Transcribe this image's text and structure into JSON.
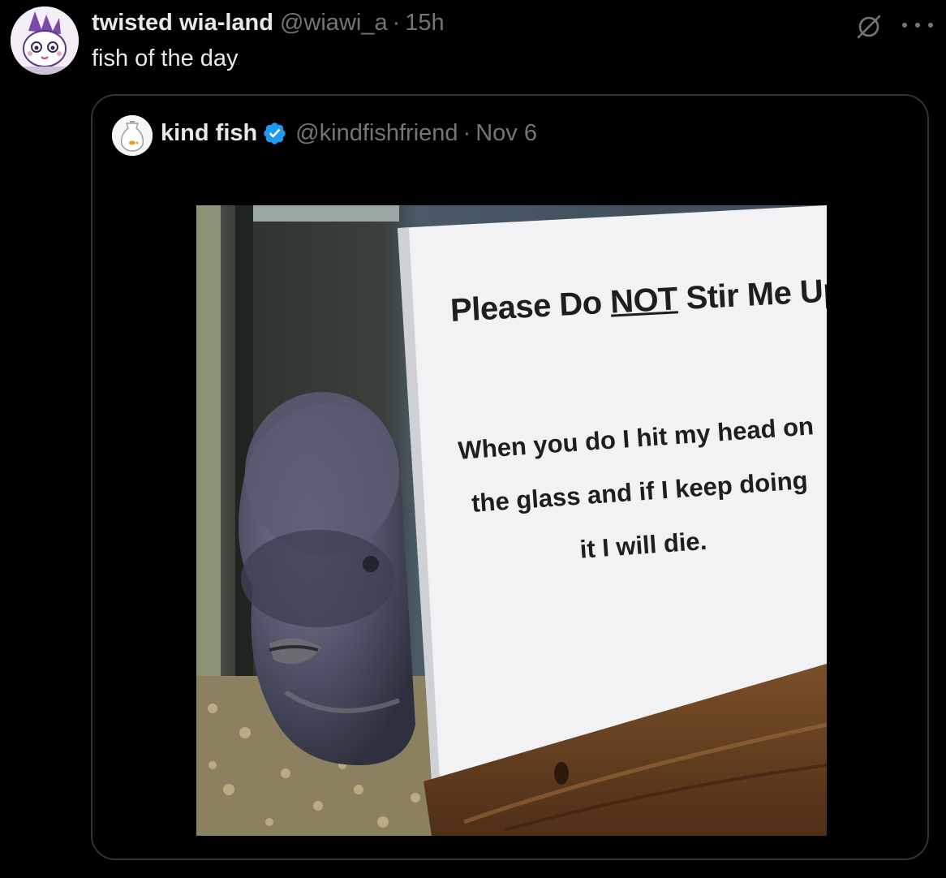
{
  "outer_tweet": {
    "display_name": "twisted wia-land",
    "handle": "@wiawi_a",
    "separator": "·",
    "time": "15h",
    "text": "fish of the day",
    "icons": {
      "avatar": "cartoon-character-avatar",
      "grok": "grok-icon",
      "more": "more-options-icon"
    }
  },
  "quoted_tweet": {
    "display_name": "kind fish",
    "handle": "@kindfishfriend",
    "separator": "·",
    "time": "Nov 6",
    "verified": true,
    "verified_color": "#1d9bf0",
    "image": {
      "description_icon": "fish-in-aquarium-photo",
      "sign": {
        "title_before": "Please Do ",
        "title_emphasis": "NOT",
        "title_after": " Stir Me Up",
        "body": "When you do I hit my head on the glass and if I keep doing it I will die."
      }
    }
  },
  "colors": {
    "background": "#000000",
    "text_primary": "#e7e9ea",
    "text_secondary": "#71767b",
    "border": "#2f3336"
  }
}
